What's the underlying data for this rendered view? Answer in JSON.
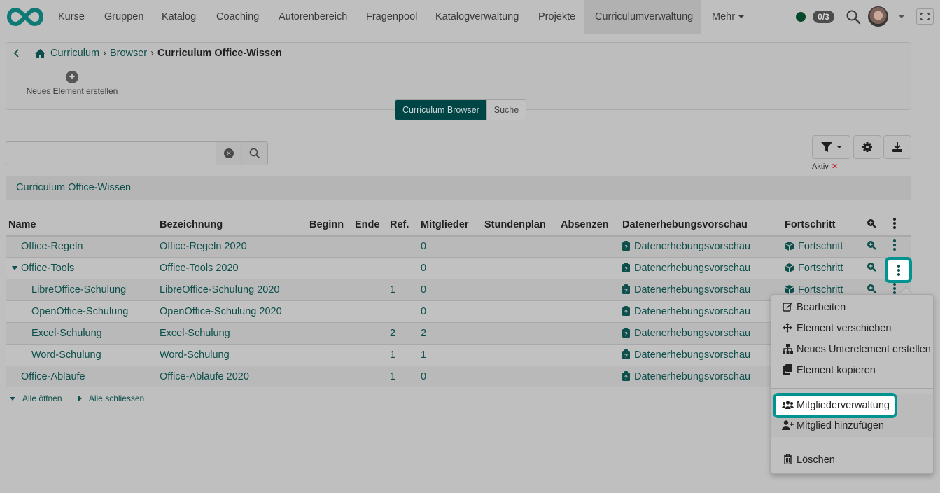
{
  "nav": {
    "items": [
      "Kurse",
      "Gruppen",
      "Katalog",
      "Coaching",
      "Autorenbereich",
      "Fragenpool",
      "Katalogverwaltung",
      "Projekte",
      "Curriculumverwaltung"
    ],
    "active": "Curriculumverwaltung",
    "more_label": "Mehr",
    "badge": "0/3",
    "status_color": "#07472a"
  },
  "breadcrumb": {
    "items": [
      "Curriculum",
      "Browser"
    ],
    "current": "Curriculum Office-Wissen"
  },
  "toolbar": {
    "new_element_label": "Neues Element erstellen"
  },
  "view_switch": {
    "browser_label": "Curriculum Browser",
    "search_label": "Suche"
  },
  "search": {
    "value": "",
    "placeholder": ""
  },
  "filter": {
    "active_label": "Aktiv"
  },
  "curriculum_title": "Curriculum Office-Wissen",
  "table": {
    "columns": [
      "Name",
      "Bezeichnung",
      "Beginn",
      "Ende",
      "Ref.",
      "Mitglieder",
      "Stundenplan",
      "Absenzen",
      "Datenerhebungsvorschau",
      "Fortschritt"
    ],
    "rows": [
      {
        "name": "Office-Regeln",
        "bez": "Office-Regeln 2020",
        "beginn": "",
        "ende": "",
        "ref": "",
        "mitglieder": "0",
        "stundenplan": "",
        "absenzen": "",
        "daten": "Datenerhebungsvorschau",
        "fortschritt": "Fortschritt"
      },
      {
        "name": "Office-Tools",
        "bez": "Office-Tools 2020",
        "beginn": "",
        "ende": "",
        "ref": "",
        "mitglieder": "0",
        "stundenplan": "",
        "absenzen": "",
        "daten": "Datenerhebungsvorschau",
        "fortschritt": "Fortschritt"
      },
      {
        "name": "LibreOffice-Schulung",
        "bez": "LibreOffice-Schulung 2020",
        "beginn": "",
        "ende": "",
        "ref": "1",
        "mitglieder": "0",
        "stundenplan": "",
        "absenzen": "",
        "daten": "Datenerhebungsvorschau",
        "fortschritt": "Fortschritt"
      },
      {
        "name": "OpenOffice-Schulung",
        "bez": "OpenOffice-Schulung 2020",
        "beginn": "",
        "ende": "",
        "ref": "",
        "mitglieder": "0",
        "stundenplan": "",
        "absenzen": "",
        "daten": "Datenerhebungsvorschau",
        "fortschritt": ""
      },
      {
        "name": "Excel-Schulung",
        "bez": "Excel-Schulung",
        "beginn": "",
        "ende": "",
        "ref": "2",
        "mitglieder": "2",
        "stundenplan": "",
        "absenzen": "",
        "daten": "Datenerhebungsvorschau",
        "fortschritt": ""
      },
      {
        "name": "Word-Schulung",
        "bez": "Word-Schulung",
        "beginn": "",
        "ende": "",
        "ref": "1",
        "mitglieder": "1",
        "stundenplan": "",
        "absenzen": "",
        "daten": "Datenerhebungsvorschau",
        "fortschritt": ""
      },
      {
        "name": "Office-Abläufe",
        "bez": "Office-Abläufe 2020",
        "beginn": "",
        "ende": "",
        "ref": "1",
        "mitglieder": "0",
        "stundenplan": "",
        "absenzen": "",
        "daten": "Datenerhebungsvorschau",
        "fortschritt": ""
      }
    ]
  },
  "tree_controls": {
    "open_all": "Alle öffnen",
    "close_all": "Alle schliessen"
  },
  "context_menu": {
    "items": [
      {
        "label": "Bearbeiten",
        "icon": "edit-icon"
      },
      {
        "label": "Element verschieben",
        "icon": "move-icon"
      },
      {
        "label": "Neues Unterelement erstellen",
        "icon": "sitemap-icon"
      },
      {
        "label": "Element kopieren",
        "icon": "copy-icon"
      },
      {
        "label": "Mitgliederverwaltung",
        "icon": "users-icon"
      },
      {
        "label": "Mitglied hinzufügen",
        "icon": "user-plus-icon"
      },
      {
        "label": "Löschen",
        "icon": "trash-icon"
      }
    ]
  },
  "colors": {
    "accent": "#00938f",
    "link": "#0d4f4b",
    "primary_button": "#004545",
    "danger": "#c0112a"
  }
}
